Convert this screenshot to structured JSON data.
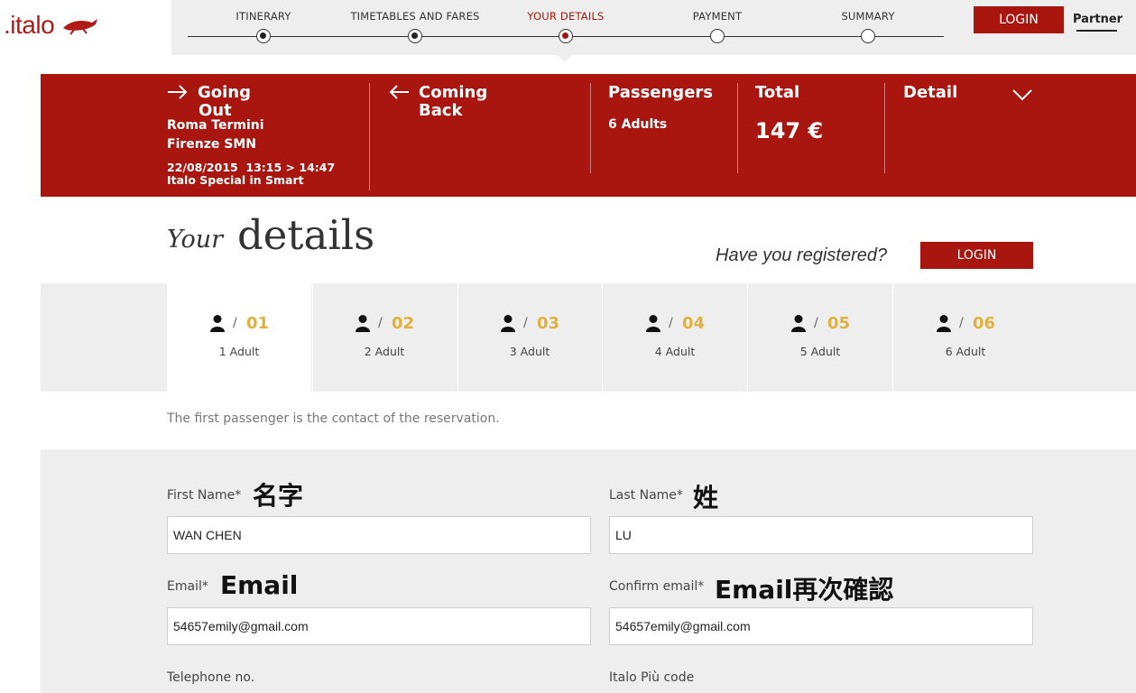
{
  "logo": {
    "text": ".italo"
  },
  "steps": [
    {
      "label": "ITINERARY",
      "state": "done"
    },
    {
      "label": "TIMETABLES AND FARES",
      "state": "done"
    },
    {
      "label": "YOUR DETAILS",
      "state": "current"
    },
    {
      "label": "PAYMENT",
      "state": "todo"
    },
    {
      "label": "SUMMARY",
      "state": "todo"
    }
  ],
  "header": {
    "login_label": "LOGIN",
    "partner_label": "Partner"
  },
  "summary": {
    "going_line1": "Going",
    "going_line2": "Out",
    "from": "Roma Termini",
    "to": "Firenze SMN",
    "datetime": "22/08/2015  13:15 > 14:47",
    "fare": "Italo Special in Smart",
    "coming_line1": "Coming",
    "coming_line2": "Back",
    "passengers_label": "Passengers",
    "passengers_value": "6 Adults",
    "total_label": "Total",
    "total_value": "147 €",
    "detail_label": "Detail"
  },
  "title": {
    "your": "Your",
    "details": "details"
  },
  "registered": {
    "question": "Have you registered?",
    "login_label": "LOGIN"
  },
  "passenger_tabs": [
    {
      "num": "01",
      "label": "1 Adult"
    },
    {
      "num": "02",
      "label": "2 Adult"
    },
    {
      "num": "03",
      "label": "3 Adult"
    },
    {
      "num": "04",
      "label": "4 Adult"
    },
    {
      "num": "05",
      "label": "5 Adult"
    },
    {
      "num": "06",
      "label": "6 Adult"
    }
  ],
  "tab_slash": "/",
  "first_note": "The first passenger is the contact of the reservation.",
  "form": {
    "first_name_label": "First Name*",
    "first_name_value": "WAN CHEN",
    "last_name_label": "Last Name*",
    "last_name_value": "LU",
    "email_label": "Email*",
    "email_value": "54657emily@gmail.com",
    "confirm_email_label": "Confirm email*",
    "confirm_email_value": "54657emily@gmail.com",
    "telephone_label": "Telephone no.",
    "italo_piu_label": "Italo Più code"
  },
  "annotations": {
    "first_name": "名字",
    "last_name": "姓",
    "email": "Email",
    "confirm_email": "Email再次確認"
  },
  "colors": {
    "brand_red": "#a8160f",
    "tab_number": "#e1b140",
    "band_gray": "#eeeeee"
  },
  "icons": [
    "arrow-right-icon",
    "arrow-left-icon",
    "chevron-down-icon",
    "person-icon"
  ]
}
